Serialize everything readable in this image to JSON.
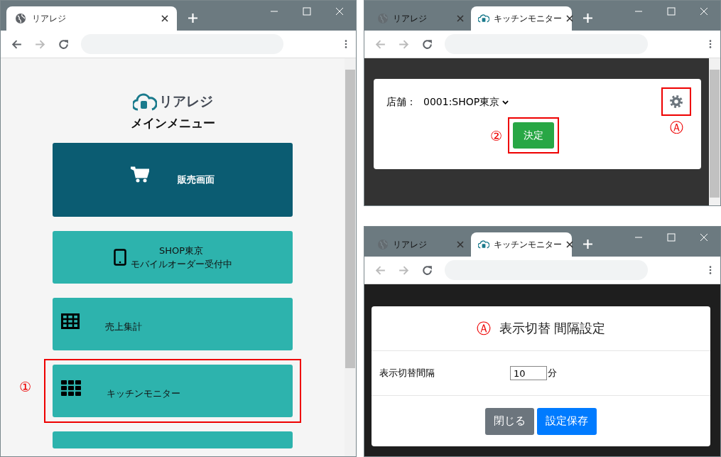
{
  "windows": [
    {
      "kind": "main_menu",
      "back_enabled": true,
      "forward_enabled": false,
      "tabs": [
        {
          "title": "リアレジ",
          "kind": "globe",
          "selected": true
        }
      ],
      "page": {
        "logo_text": "リアレジ",
        "heading": "メインメニュー",
        "items": [
          {
            "kind": "cart",
            "lines": [
              "販売画面"
            ],
            "color": "#0b5c72"
          },
          {
            "kind": "tablet",
            "lines": [
              "SHOP東京",
              "モバイルオーダー受付中"
            ],
            "color": "#2db3ad"
          },
          {
            "kind": "table",
            "lines": [
              "売上集計"
            ],
            "color": "#2db3ad"
          },
          {
            "kind": "grid",
            "lines": [
              "キッチンモニター"
            ],
            "color": "#2db3ad",
            "annotation": "①"
          },
          {
            "kind": "blank",
            "color": "#2db3ad"
          }
        ]
      }
    },
    {
      "kind": "store_select",
      "back_enabled": false,
      "forward_enabled": false,
      "tabs": [
        {
          "title": "リアレジ",
          "kind": "globe",
          "selected": false
        },
        {
          "title": "キッチンモニター",
          "kind": "app",
          "selected": true
        }
      ],
      "page": {
        "store_label": "店舗：",
        "store_value": "0001:SHOP東京",
        "settings_annotation": "Ⓐ",
        "confirm_button": "決定",
        "confirm_annotation": "②"
      }
    },
    {
      "kind": "settings_dialog",
      "back_enabled": false,
      "forward_enabled": false,
      "tabs": [
        {
          "title": "リアレジ",
          "kind": "globe",
          "selected": false
        },
        {
          "title": "キッチンモニター",
          "kind": "app",
          "selected": true
        }
      ],
      "page": {
        "title_annotation": "Ⓐ",
        "title": "表示切替 間隔設定",
        "field_label": "表示切替間隔",
        "field_value": "10",
        "unit": "分",
        "buttons": [
          {
            "label": "閉じる",
            "kind": "secondary"
          },
          {
            "label": "設定保存",
            "kind": "primary"
          }
        ]
      }
    }
  ]
}
